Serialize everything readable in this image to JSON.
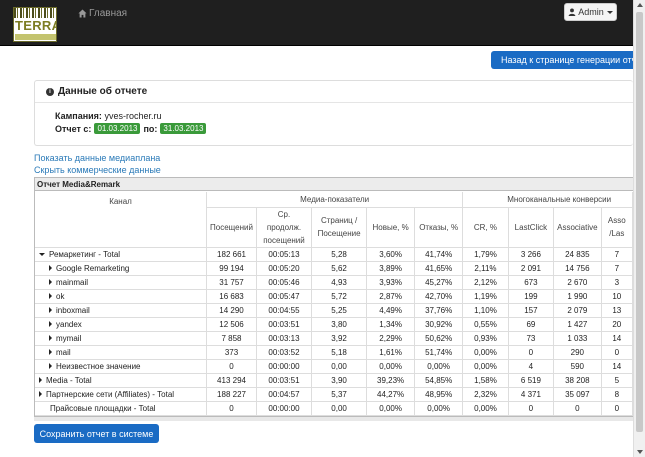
{
  "navbar": {
    "logo_text": "TERRA",
    "home_label": "Главная",
    "admin_label": "Admin"
  },
  "back_button": "Назад к странице генерации отчета",
  "report_info": {
    "title": "Данные об отчете",
    "campaign_label": "Кампания:",
    "campaign_value": "yves-rocher.ru",
    "period_label": "Отчет с:",
    "date_from": "01.03.2013",
    "to_label": "по:",
    "date_to": "31.03.2013"
  },
  "links": {
    "show_mediaplan": "Показать данные медиаплана",
    "hide_commercial": "Скрыть коммерческие данные"
  },
  "media_table": {
    "title": "Отчет Media&Remark",
    "group_headers": [
      "Канал",
      "Медиа-показатели",
      "Многоканальные конверсии"
    ],
    "columns": [
      "Посещений",
      "Ср. продолж. посещений",
      "Страниц /Посещение",
      "Новые, %",
      "Отказы, %",
      "CR, %",
      "LastClick",
      "Associative",
      "Asso /Las"
    ],
    "rows": [
      {
        "channel": "Ремаркетинг - Total",
        "level": 0,
        "expander": "down",
        "cells": [
          "182 661",
          "00:05:13",
          "5,28",
          "3,60%",
          "41,74%",
          "1,79%",
          "3 266",
          "24 835",
          "7"
        ]
      },
      {
        "channel": "Google Remarketing",
        "level": 1,
        "expander": "right",
        "cells": [
          "99 194",
          "00:05:20",
          "5,62",
          "3,89%",
          "41,65%",
          "2,11%",
          "2 091",
          "14 756",
          "7"
        ]
      },
      {
        "channel": "mainmail",
        "level": 1,
        "expander": "right",
        "cells": [
          "31 757",
          "00:05:46",
          "4,93",
          "3,93%",
          "45,27%",
          "2,12%",
          "673",
          "2 670",
          "3"
        ]
      },
      {
        "channel": "ok",
        "level": 1,
        "expander": "right",
        "cells": [
          "16 683",
          "00:05:47",
          "5,72",
          "2,87%",
          "42,70%",
          "1,19%",
          "199",
          "1 990",
          "10"
        ]
      },
      {
        "channel": "inboxmail",
        "level": 1,
        "expander": "right",
        "cells": [
          "14 290",
          "00:04:55",
          "5,25",
          "4,49%",
          "37,76%",
          "1,10%",
          "157",
          "2 079",
          "13"
        ]
      },
      {
        "channel": "yandex",
        "level": 1,
        "expander": "right",
        "cells": [
          "12 506",
          "00:03:51",
          "3,80",
          "1,34%",
          "30,92%",
          "0,55%",
          "69",
          "1 427",
          "20"
        ]
      },
      {
        "channel": "mymail",
        "level": 1,
        "expander": "right",
        "cells": [
          "7 858",
          "00:03:13",
          "3,92",
          "2,29%",
          "50,62%",
          "0,93%",
          "73",
          "1 033",
          "14"
        ]
      },
      {
        "channel": "mail",
        "level": 1,
        "expander": "right",
        "cells": [
          "373",
          "00:03:52",
          "5,18",
          "1,61%",
          "51,74%",
          "0,00%",
          "0",
          "290",
          "0"
        ]
      },
      {
        "channel": "Неизвестное значение",
        "level": 1,
        "expander": "right",
        "cells": [
          "0",
          "00:00:00",
          "0,00",
          "0,00%",
          "0,00%",
          "0,00%",
          "4",
          "590",
          "14"
        ]
      },
      {
        "channel": "Media - Total",
        "level": 0,
        "expander": "right",
        "cells": [
          "413 294",
          "00:03:51",
          "3,90",
          "39,23%",
          "54,85%",
          "1,58%",
          "6 519",
          "38 208",
          "5"
        ]
      },
      {
        "channel": "Партнерские сети (Affiliates) - Total",
        "level": 0,
        "expander": "right",
        "cells": [
          "188 227",
          "00:04:57",
          "5,37",
          "44,27%",
          "48,95%",
          "2,32%",
          "4 371",
          "35 097",
          "8"
        ]
      },
      {
        "channel": "Прайсовые площадки - Total",
        "level": 0,
        "expander": "none",
        "cells": [
          "0",
          "00:00:00",
          "0,00",
          "0,00%",
          "0,00%",
          "0,00%",
          "0",
          "0",
          "0"
        ]
      }
    ]
  },
  "save_button": "Сохранить отчет в системе"
}
